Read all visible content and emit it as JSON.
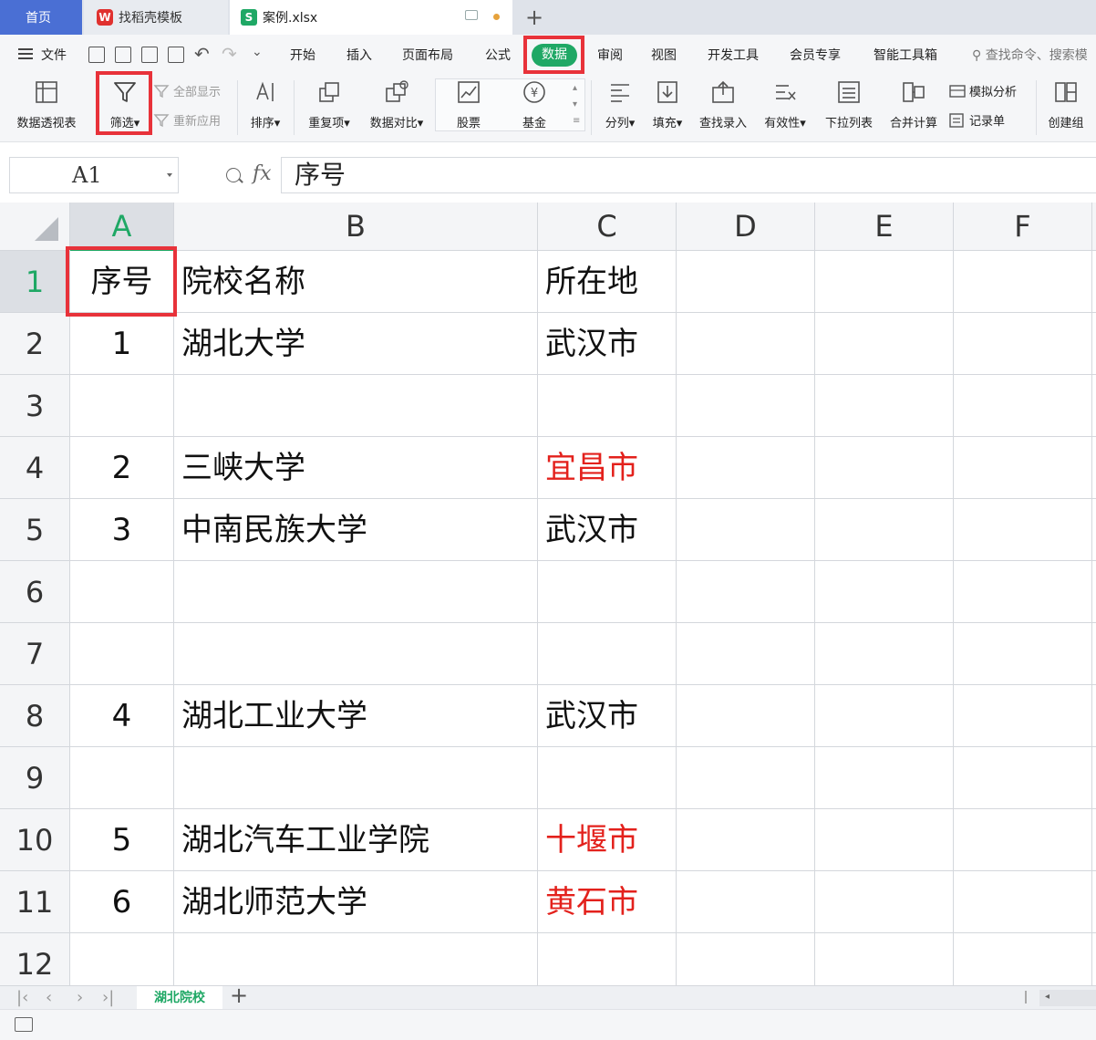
{
  "tabs": {
    "home": "首页",
    "wps_template": "找稻壳模板",
    "file": "案例.xlsx"
  },
  "menu": {
    "file": "文件",
    "items": [
      "开始",
      "插入",
      "页面布局",
      "公式",
      "数据",
      "审阅",
      "视图",
      "开发工具",
      "会员专享",
      "智能工具箱"
    ],
    "search": "查找命令、搜索模"
  },
  "ribbon": {
    "pivot": "数据透视表",
    "filter": "筛选",
    "show_all": "全部显示",
    "reapply": "重新应用",
    "sort": "排序",
    "duplicates": "重复项",
    "compare": "数据对比",
    "stocks": "股票",
    "funds": "基金",
    "split": "分列",
    "fill": "填充",
    "lookup": "查找录入",
    "validity": "有效性",
    "dropdown": "下拉列表",
    "consolidate": "合并计算",
    "whatif": "模拟分析",
    "record": "记录单",
    "group": "创建组"
  },
  "formula_bar": {
    "name_box": "A1",
    "fx": "fx",
    "content": "序号"
  },
  "columns": [
    "A",
    "B",
    "C",
    "D",
    "E",
    "F"
  ],
  "rows": [
    {
      "num": "1",
      "a": "序号",
      "b": "院校名称",
      "c": "所在地",
      "c_red": false
    },
    {
      "num": "2",
      "a": "1",
      "b": "湖北大学",
      "c": "武汉市",
      "c_red": false
    },
    {
      "num": "3",
      "a": "",
      "b": "",
      "c": "",
      "c_red": false
    },
    {
      "num": "4",
      "a": "2",
      "b": "三峡大学",
      "c": "宜昌市",
      "c_red": true
    },
    {
      "num": "5",
      "a": "3",
      "b": "中南民族大学",
      "c": "武汉市",
      "c_red": false
    },
    {
      "num": "6",
      "a": "",
      "b": "",
      "c": "",
      "c_red": false
    },
    {
      "num": "7",
      "a": "",
      "b": "",
      "c": "",
      "c_red": false
    },
    {
      "num": "8",
      "a": "4",
      "b": "湖北工业大学",
      "c": "武汉市",
      "c_red": false
    },
    {
      "num": "9",
      "a": "",
      "b": "",
      "c": "",
      "c_red": false
    },
    {
      "num": "10",
      "a": "5",
      "b": "湖北汽车工业学院",
      "c": "十堰市",
      "c_red": true
    },
    {
      "num": "11",
      "a": "6",
      "b": "湖北师范大学",
      "c": "黄石市",
      "c_red": true
    },
    {
      "num": "12",
      "a": "",
      "b": "",
      "c": "",
      "c_red": false
    }
  ],
  "sheet": {
    "active": "湖北院校"
  },
  "colors": {
    "accent_green": "#1fa865",
    "highlight_red": "#e8323a",
    "text_red": "#e3211c",
    "home_tab_blue": "#4a6fd4"
  }
}
